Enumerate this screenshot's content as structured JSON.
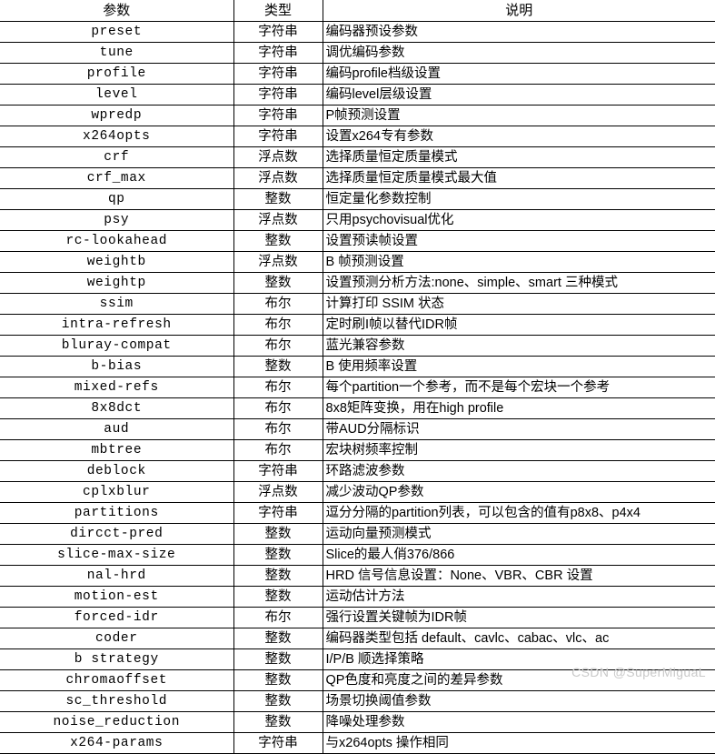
{
  "table": {
    "headers": {
      "param": "参数",
      "type": "类型",
      "desc": "说明"
    },
    "rows": [
      {
        "param": "preset",
        "type": "字符串",
        "desc": "编码器预设参数"
      },
      {
        "param": "tune",
        "type": "字符串",
        "desc": "调优编码参数"
      },
      {
        "param": "profile",
        "type": "字符串",
        "desc": "编码profile档级设置"
      },
      {
        "param": "level",
        "type": "字符串",
        "desc": "编码level层级设置"
      },
      {
        "param": "wpredp",
        "type": "字符串",
        "desc": "P帧预测设置"
      },
      {
        "param": "x264opts",
        "type": "字符串",
        "desc": "设置x264专有参数"
      },
      {
        "param": "crf",
        "type": "浮点数",
        "desc": "选择质量恒定质量模式"
      },
      {
        "param": "crf_max",
        "type": "浮点数",
        "desc": "选择质量恒定质量模式最大值"
      },
      {
        "param": "qp",
        "type": "整数",
        "desc": "恒定量化参数控制"
      },
      {
        "param": "psy",
        "type": "浮点数",
        "desc": "只用psychovisual优化"
      },
      {
        "param": "rc-lookahead",
        "type": "整数",
        "desc": "设置预读帧设置"
      },
      {
        "param": "weightb",
        "type": "浮点数",
        "desc": "B 帧预测设置"
      },
      {
        "param": "weightp",
        "type": "整数",
        "desc": "设置预测分析方法:none、simple、smart 三种模式"
      },
      {
        "param": "ssim",
        "type": "布尔",
        "desc": "计算打印 SSIM 状态"
      },
      {
        "param": "intra-refresh",
        "type": "布尔",
        "desc": "定时刷I帧以替代IDR帧"
      },
      {
        "param": "bluray-compat",
        "type": "布尔",
        "desc": "蓝光兼容参数"
      },
      {
        "param": "b-bias",
        "type": "整数",
        "desc": "B 使用频率设置"
      },
      {
        "param": "mixed-refs",
        "type": "布尔",
        "desc": "每个partition一个参考，而不是每个宏块一个参考"
      },
      {
        "param": "8x8dct",
        "type": "布尔",
        "desc": "8x8矩阵变换，用在high profile"
      },
      {
        "param": "aud",
        "type": "布尔",
        "desc": "带AUD分隔标识"
      },
      {
        "param": "mbtree",
        "type": "布尔",
        "desc": "宏块树频率控制"
      },
      {
        "param": "deblock",
        "type": "字符串",
        "desc": "环路滤波参数"
      },
      {
        "param": "cplxblur",
        "type": "浮点数",
        "desc": "减少波动QP参数"
      },
      {
        "param": "partitions",
        "type": "字符串",
        "desc": "逗分分隔的partition列表，可以包含的值有p8x8、p4x4"
      },
      {
        "param": "dircct-pred",
        "type": "整数",
        "desc": "运动向量预测模式"
      },
      {
        "param": "slice-max-size",
        "type": "整数",
        "desc": "Slice的最人俏376/866"
      },
      {
        "param": "nal-hrd",
        "type": "整数",
        "desc": "HRD 信号信息设置：None、VBR、CBR 设置"
      },
      {
        "param": "motion-est",
        "type": "整数",
        "desc": "运动估计方法"
      },
      {
        "param": "forced-idr",
        "type": "布尔",
        "desc": "强行设置关键帧为IDR帧"
      },
      {
        "param": "coder",
        "type": "整数",
        "desc": "编码器类型包括 default、cavlc、cabac、vlc、ac"
      },
      {
        "param": "b strategy",
        "type": "整数",
        "desc": "I/P/B 顺选择策略"
      },
      {
        "param": "chromaoffset",
        "type": "整数",
        "desc": "QP色度和亮度之间的差异参数"
      },
      {
        "param": "sc_threshold",
        "type": "整数",
        "desc": "场景切换阈值参数"
      },
      {
        "param": "noise_reduction",
        "type": "整数",
        "desc": "降噪处理参数"
      },
      {
        "param": "x264-params",
        "type": "字符串",
        "desc": "与x264opts 操作相同"
      }
    ]
  },
  "watermark": {
    "text": "CSDN @SuperMiguaL"
  }
}
